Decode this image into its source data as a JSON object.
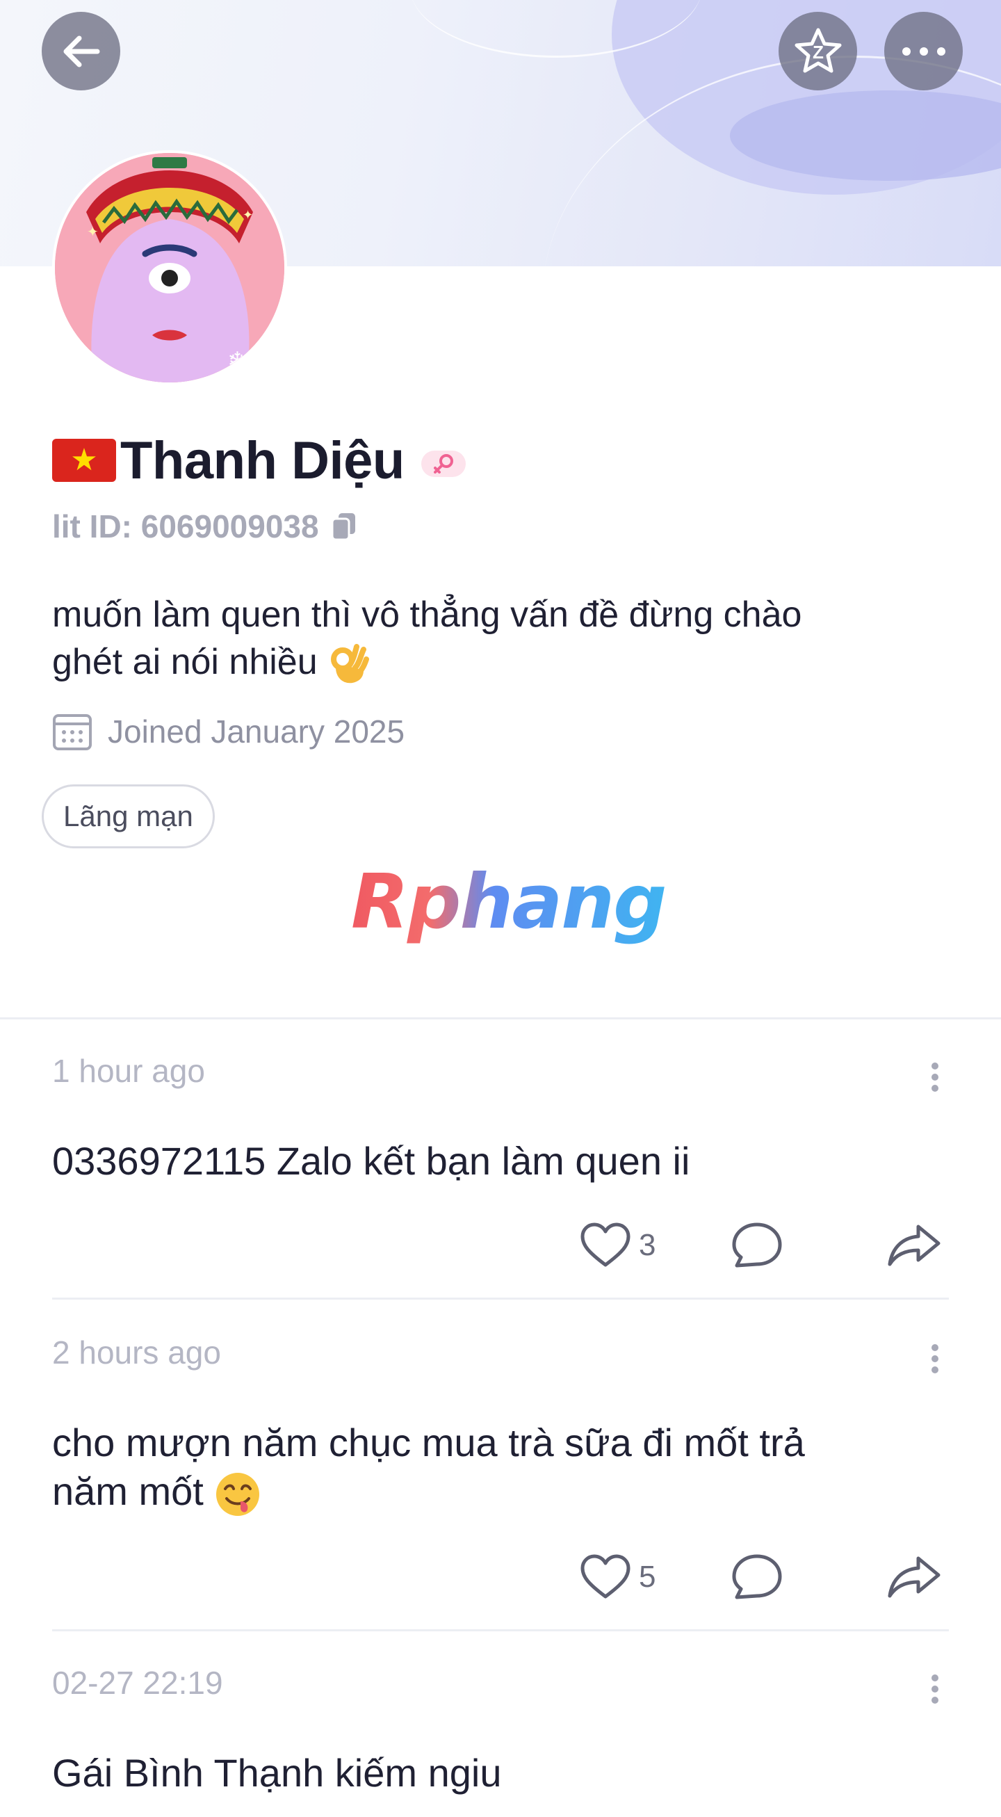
{
  "header": {
    "back_icon": "arrow-left-icon",
    "favorite_icon": "star-icon",
    "more_icon": "more-horizontal-icon"
  },
  "profile": {
    "flag_icon": "vietnam-flag-icon",
    "name": "Thanh Diệu",
    "gender_icon": "female-symbol-icon",
    "lit_id": "lit ID: 6069009038",
    "bio_line1": "muốn làm quen thì vô thẳng vấn đề đừng chào",
    "bio_line2": "ghét ai nói nhiều",
    "joined": "Joined January 2025",
    "tag": "Lãng mạn"
  },
  "watermark": "Rphang",
  "posts": [
    {
      "time": "1 hour ago",
      "text": "0336972115 Zalo kết bạn làm quen ii",
      "likes": "3"
    },
    {
      "time": "2 hours ago",
      "text_line1": "cho mượn năm chục mua trà sữa đi mốt trả",
      "text_line2": "năm mốt",
      "likes": "5"
    },
    {
      "time": "02-27 22:19",
      "text": "Gái Bình Thạnh kiếm ngiu"
    }
  ],
  "colors": {
    "accent_text": "#1f2033",
    "muted_text": "#b4b6c4",
    "button_bg": "#6e7084",
    "banner_blob": "#c9cbf5"
  }
}
